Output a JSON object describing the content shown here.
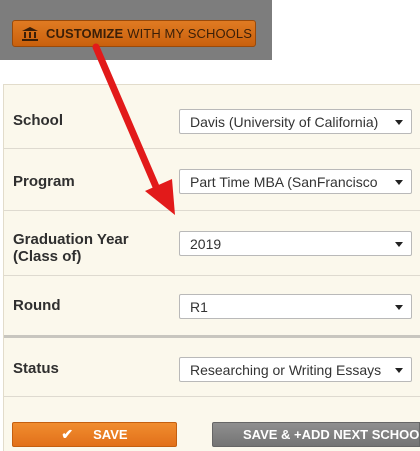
{
  "customize": {
    "label_bold": "CUSTOMIZE",
    "label_rest": "WITH MY SCHOOLS",
    "icon": "bank-icon"
  },
  "form": {
    "fields": [
      {
        "label": "School",
        "value": "Davis (University of California)"
      },
      {
        "label": "Program",
        "value": "Part Time MBA (SanFrancisco"
      },
      {
        "label_line1": "Graduation Year",
        "label_line2": "(Class of)",
        "value": "2019"
      },
      {
        "label": "Round",
        "value": "R1"
      },
      {
        "label": "Status",
        "value": "Researching or Writing Essays"
      }
    ]
  },
  "actions": {
    "save_label": "SAVE",
    "save_next_label": "SAVE & +ADD NEXT SCHOOL"
  },
  "colors": {
    "accent_orange": "#e2701a",
    "arrow_red": "#e21a1a",
    "panel_bg": "#fbf8ec"
  }
}
